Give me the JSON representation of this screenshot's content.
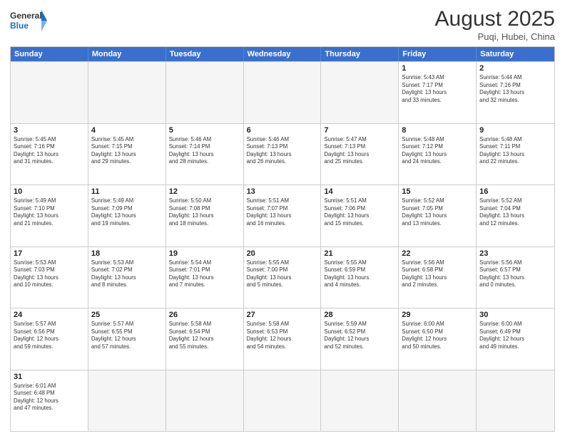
{
  "logo": {
    "general": "General",
    "blue": "Blue"
  },
  "title": "August 2025",
  "subtitle": "Puqi, Hubei, China",
  "days": [
    "Sunday",
    "Monday",
    "Tuesday",
    "Wednesday",
    "Thursday",
    "Friday",
    "Saturday"
  ],
  "rows": [
    [
      {
        "day": "",
        "info": "",
        "empty": true
      },
      {
        "day": "",
        "info": "",
        "empty": true
      },
      {
        "day": "",
        "info": "",
        "empty": true
      },
      {
        "day": "",
        "info": "",
        "empty": true
      },
      {
        "day": "",
        "info": "",
        "empty": true
      },
      {
        "day": "1",
        "info": "Sunrise: 5:43 AM\nSunset: 7:17 PM\nDaylight: 13 hours\nand 33 minutes."
      },
      {
        "day": "2",
        "info": "Sunrise: 5:44 AM\nSunset: 7:16 PM\nDaylight: 13 hours\nand 32 minutes."
      }
    ],
    [
      {
        "day": "3",
        "info": "Sunrise: 5:45 AM\nSunset: 7:16 PM\nDaylight: 13 hours\nand 31 minutes."
      },
      {
        "day": "4",
        "info": "Sunrise: 5:45 AM\nSunset: 7:15 PM\nDaylight: 13 hours\nand 29 minutes."
      },
      {
        "day": "5",
        "info": "Sunrise: 5:46 AM\nSunset: 7:14 PM\nDaylight: 13 hours\nand 28 minutes."
      },
      {
        "day": "6",
        "info": "Sunrise: 5:46 AM\nSunset: 7:13 PM\nDaylight: 13 hours\nand 26 minutes."
      },
      {
        "day": "7",
        "info": "Sunrise: 5:47 AM\nSunset: 7:13 PM\nDaylight: 13 hours\nand 25 minutes."
      },
      {
        "day": "8",
        "info": "Sunrise: 5:48 AM\nSunset: 7:12 PM\nDaylight: 13 hours\nand 24 minutes."
      },
      {
        "day": "9",
        "info": "Sunrise: 5:48 AM\nSunset: 7:11 PM\nDaylight: 13 hours\nand 22 minutes."
      }
    ],
    [
      {
        "day": "10",
        "info": "Sunrise: 5:49 AM\nSunset: 7:10 PM\nDaylight: 13 hours\nand 21 minutes."
      },
      {
        "day": "11",
        "info": "Sunrise: 5:49 AM\nSunset: 7:09 PM\nDaylight: 13 hours\nand 19 minutes."
      },
      {
        "day": "12",
        "info": "Sunrise: 5:50 AM\nSunset: 7:08 PM\nDaylight: 13 hours\nand 18 minutes."
      },
      {
        "day": "13",
        "info": "Sunrise: 5:51 AM\nSunset: 7:07 PM\nDaylight: 13 hours\nand 16 minutes."
      },
      {
        "day": "14",
        "info": "Sunrise: 5:51 AM\nSunset: 7:06 PM\nDaylight: 13 hours\nand 15 minutes."
      },
      {
        "day": "15",
        "info": "Sunrise: 5:52 AM\nSunset: 7:05 PM\nDaylight: 13 hours\nand 13 minutes."
      },
      {
        "day": "16",
        "info": "Sunrise: 5:52 AM\nSunset: 7:04 PM\nDaylight: 13 hours\nand 12 minutes."
      }
    ],
    [
      {
        "day": "17",
        "info": "Sunrise: 5:53 AM\nSunset: 7:03 PM\nDaylight: 13 hours\nand 10 minutes."
      },
      {
        "day": "18",
        "info": "Sunrise: 5:53 AM\nSunset: 7:02 PM\nDaylight: 13 hours\nand 8 minutes."
      },
      {
        "day": "19",
        "info": "Sunrise: 5:54 AM\nSunset: 7:01 PM\nDaylight: 13 hours\nand 7 minutes."
      },
      {
        "day": "20",
        "info": "Sunrise: 5:55 AM\nSunset: 7:00 PM\nDaylight: 13 hours\nand 5 minutes."
      },
      {
        "day": "21",
        "info": "Sunrise: 5:55 AM\nSunset: 6:59 PM\nDaylight: 13 hours\nand 4 minutes."
      },
      {
        "day": "22",
        "info": "Sunrise: 5:56 AM\nSunset: 6:58 PM\nDaylight: 13 hours\nand 2 minutes."
      },
      {
        "day": "23",
        "info": "Sunrise: 5:56 AM\nSunset: 6:57 PM\nDaylight: 13 hours\nand 0 minutes."
      }
    ],
    [
      {
        "day": "24",
        "info": "Sunrise: 5:57 AM\nSunset: 6:56 PM\nDaylight: 12 hours\nand 59 minutes."
      },
      {
        "day": "25",
        "info": "Sunrise: 5:57 AM\nSunset: 6:55 PM\nDaylight: 12 hours\nand 57 minutes."
      },
      {
        "day": "26",
        "info": "Sunrise: 5:58 AM\nSunset: 6:54 PM\nDaylight: 12 hours\nand 55 minutes."
      },
      {
        "day": "27",
        "info": "Sunrise: 5:58 AM\nSunset: 6:53 PM\nDaylight: 12 hours\nand 54 minutes."
      },
      {
        "day": "28",
        "info": "Sunrise: 5:59 AM\nSunset: 6:52 PM\nDaylight: 12 hours\nand 52 minutes."
      },
      {
        "day": "29",
        "info": "Sunrise: 6:00 AM\nSunset: 6:50 PM\nDaylight: 12 hours\nand 50 minutes."
      },
      {
        "day": "30",
        "info": "Sunrise: 6:00 AM\nSunset: 6:49 PM\nDaylight: 12 hours\nand 49 minutes."
      }
    ],
    [
      {
        "day": "31",
        "info": "Sunrise: 6:01 AM\nSunset: 6:48 PM\nDaylight: 12 hours\nand 47 minutes."
      },
      {
        "day": "",
        "info": "",
        "empty": true
      },
      {
        "day": "",
        "info": "",
        "empty": true
      },
      {
        "day": "",
        "info": "",
        "empty": true
      },
      {
        "day": "",
        "info": "",
        "empty": true
      },
      {
        "day": "",
        "info": "",
        "empty": true
      },
      {
        "day": "",
        "info": "",
        "empty": true
      }
    ]
  ]
}
